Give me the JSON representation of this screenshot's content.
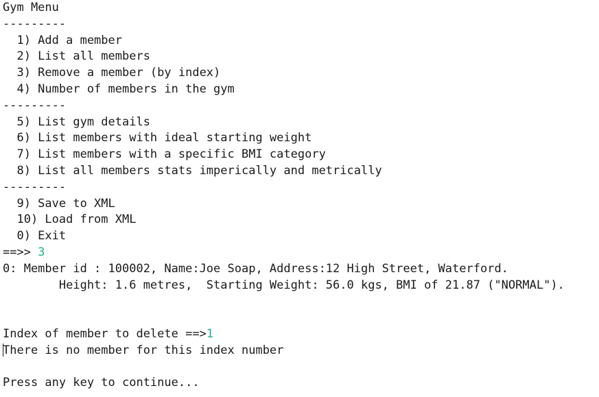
{
  "console": {
    "title": "Gym Menu",
    "separator": "---------",
    "group1": [
      "  1) Add a member",
      "  2) List all members",
      "  3) Remove a member (by index)",
      "  4) Number of members in the gym"
    ],
    "group2": [
      "  5) List gym details",
      "  6) List members with ideal starting weight",
      "  7) List members with a specific BMI category",
      "  8) List all members stats imperically and metrically"
    ],
    "group3": [
      "  9) Save to XML",
      "  10) Load from XML",
      "  0) Exit"
    ],
    "prompt": "==>> ",
    "prompt_input": "3",
    "member_line1": "0: Member id : 100002, Name:Joe Soap, Address:12 High Street, Waterford.",
    "member_line2": "        Height: 1.6 metres,  Starting Weight: 56.0 kgs, BMI of 21.87 (\"NORMAL\").",
    "delete_prompt": "Index of member to delete ==>",
    "delete_input": "1",
    "error_message": "There is no member for this index number",
    "continue_message": "Press any key to continue..."
  },
  "colors": {
    "text": "#1a1a1a",
    "user_input": "#19b08a",
    "background": "#ffffff"
  }
}
